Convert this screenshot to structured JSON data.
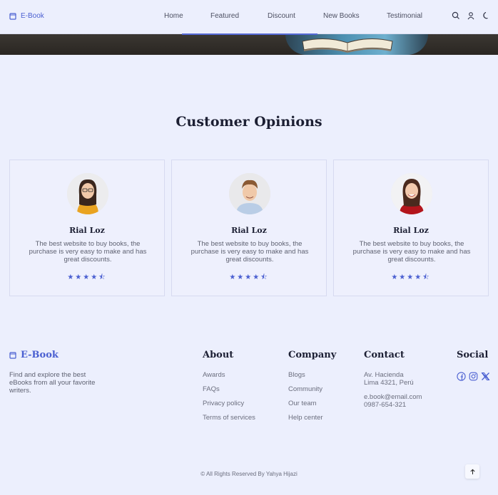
{
  "brand": {
    "name": "E-Book",
    "accent": "#4a5fd1"
  },
  "nav": {
    "items": [
      "Home",
      "Featured",
      "Discount",
      "New Books",
      "Testimonial"
    ],
    "tools": [
      "search-icon",
      "user-icon",
      "moon-icon"
    ]
  },
  "testimonials": {
    "title": "Customer Opinions",
    "cards": [
      {
        "name": "Rial Loz",
        "text": "The best website to buy books, the purchase is very easy to make and has great discounts.",
        "rating": 4.5,
        "stars": "★★★★⯪"
      },
      {
        "name": "Rial Loz",
        "text": "The best website to buy books, the purchase is very easy to make and has great discounts.",
        "rating": 4.5,
        "stars": "★★★★⯪"
      },
      {
        "name": "Rial Loz",
        "text": "The best website to buy books, the purchase is very easy to make and has great discounts.",
        "rating": 4.5,
        "stars": "★★★★⯪"
      }
    ]
  },
  "footer": {
    "brand": "E-Book",
    "description": "Find and explore the best eBooks from all your favorite writers.",
    "about": {
      "title": "About",
      "links": [
        "Awards",
        "FAQs",
        "Privacy policy",
        "Terms of services"
      ]
    },
    "company": {
      "title": "Company",
      "links": [
        "Blogs",
        "Community",
        "Our team",
        "Help center"
      ]
    },
    "contact": {
      "title": "Contact",
      "address_line1": "Av. Hacienda",
      "address_line2": "Lima 4321, Perú",
      "email": "e.book@email.com",
      "phone": "0987-654-321"
    },
    "social": {
      "title": "Social",
      "icons": [
        "facebook-icon",
        "instagram-icon",
        "x-twitter-icon"
      ]
    },
    "copyright": "© All Rights Reserved By Yahya Hijazi"
  }
}
